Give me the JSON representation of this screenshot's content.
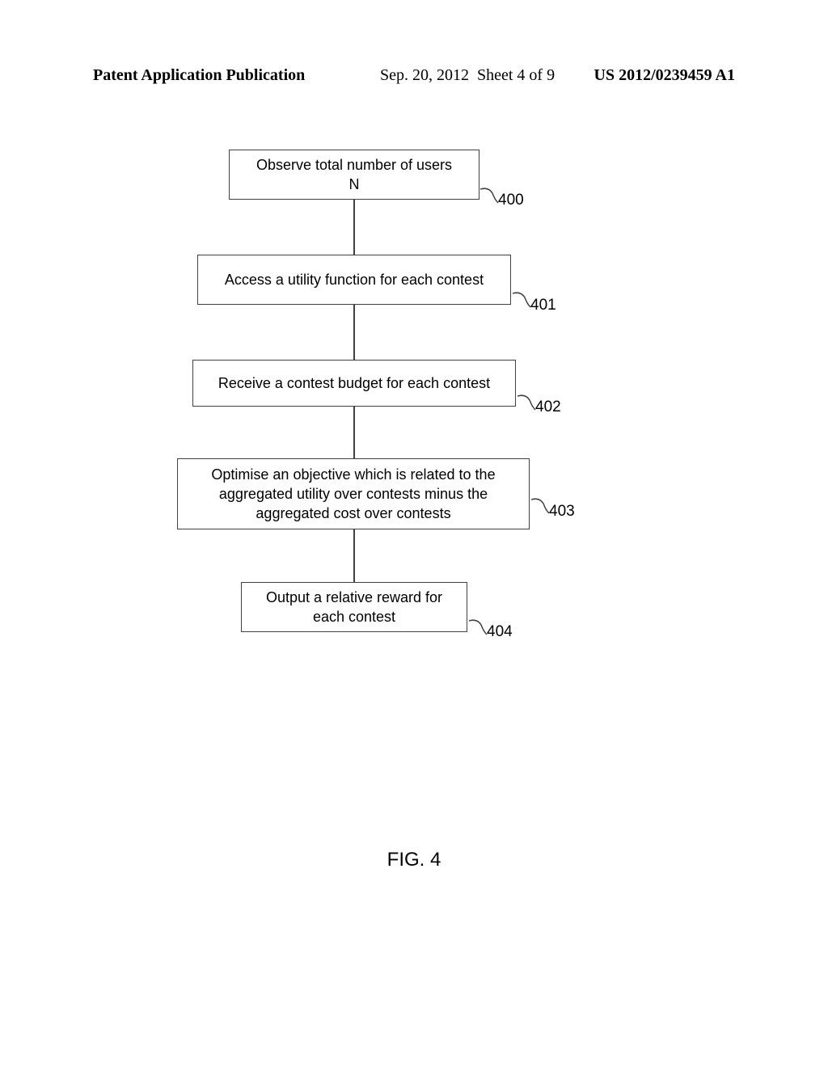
{
  "header": {
    "left": "Patent Application Publication",
    "date": "Sep. 20, 2012",
    "sheet": "Sheet 4 of 9",
    "right": "US 2012/0239459 A1"
  },
  "flow": {
    "boxes": [
      {
        "text": "Observe total number of users\nN",
        "ref": "400"
      },
      {
        "text": "Access a utility function for each contest",
        "ref": "401"
      },
      {
        "text": "Receive a contest budget for each contest",
        "ref": "402"
      },
      {
        "text": "Optimise an objective which is related to the\naggregated utility over contests minus the\naggregated cost over contests",
        "ref": "403"
      },
      {
        "text": "Output a relative reward for\neach contest",
        "ref": "404"
      }
    ]
  },
  "figure_label": "FIG. 4"
}
